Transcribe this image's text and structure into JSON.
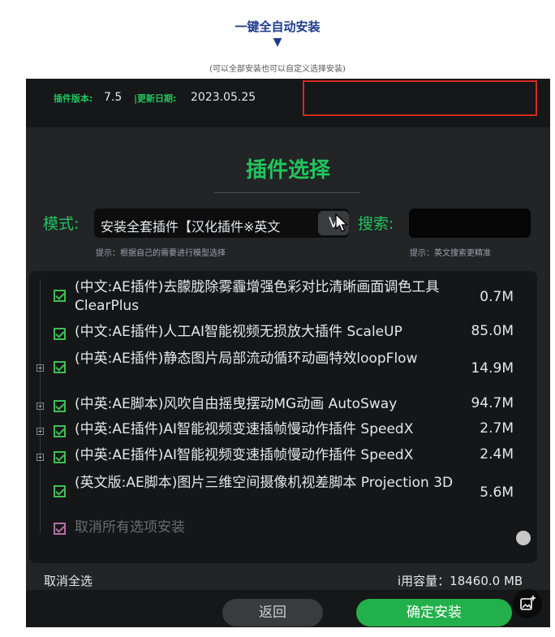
{
  "header": {
    "title": "一键全自动安装",
    "arrow": "▼",
    "subtitle": "(可以全部安装也可以自定义选择安装)"
  },
  "version": {
    "label": "插件版本:",
    "value": "7.5",
    "update_label": "|更新日期:",
    "update_value": "2023.05.25"
  },
  "section_title": "插件选择",
  "mode": {
    "label": "模式:",
    "selected": "安装全套插件【汉化插件※英文",
    "dropdown_glyph": "V",
    "hint": "提示：根据自己的需要进行模型选择"
  },
  "search": {
    "label": "搜索:",
    "placeholder": "",
    "hint": "提示：英文搜索更精准"
  },
  "items": [
    {
      "label": "(中文:AE插件)去朦胧除雾霾增强色彩对比清晰画面调色工具ClearPlus",
      "size": "0.7M",
      "expandable": false
    },
    {
      "label": "(中文:AE插件)人工AI智能视频无损放大插件 ScaleUP",
      "size": "85.0M",
      "expandable": false
    },
    {
      "label": "(中英:AE插件)静态图片局部流动循环动画特效loopFlow",
      "size": "14.9M",
      "expandable": true
    },
    {
      "label": "(中英:AE脚本)风吹自由摇曳摆动MG动画 AutoSway",
      "size": "94.7M",
      "expandable": true
    },
    {
      "label": "(中英:AE插件)AI智能视频变速插帧慢动作插件 SpeedX",
      "size": "2.7M",
      "expandable": true
    },
    {
      "label": "(中英:AE插件)AI智能视频变速插帧慢动作插件 SpeedX",
      "size": "2.4M",
      "expandable": true
    },
    {
      "label": "(英文版:AE脚本)图片三维空间摄像机视差脚本 Projection 3D",
      "size": "5.6M",
      "expandable": false
    }
  ],
  "cancel_all_option": "取消所有选项安装",
  "footer": {
    "deselect_all": "取消全选",
    "capacity": "i用容量：18460.0 MB",
    "back": "返回",
    "confirm": "确定安装"
  },
  "colors": {
    "accent_green": "#22c55e",
    "highlight_red": "#d42a20",
    "title_blue": "#1e3a8a"
  }
}
